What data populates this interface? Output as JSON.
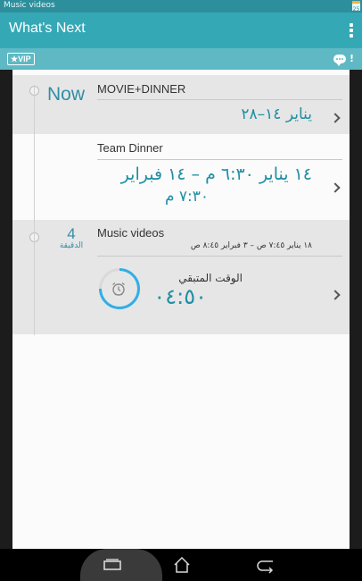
{
  "status_bar": {
    "text": "Music videos",
    "calendar_day": "25"
  },
  "app_bar": {
    "title": "What's Next",
    "menu_icon": "overflow-icon"
  },
  "vip_bar": {
    "badge": "★VIP",
    "alert_mark": "!",
    "chat_icon": "chat-icon"
  },
  "timeline": {
    "now_label": "Now",
    "events": [
      {
        "title": "MOVIE+DINNER",
        "date": "يناير ١٤–٢٨"
      },
      {
        "title": "Team Dinner",
        "date_line1": "١٤ يناير ٦:٣٠ م – ١٤ فبراير",
        "date_line2": "٧:٣٠ م"
      },
      {
        "title": "Music videos",
        "date": "١٨ يناير ٧:٤٥ ص – ٣ فبراير ٨:٤٥ ص",
        "duration_value": "4",
        "duration_unit": "الدقيقة",
        "remaining_label": "الوقت المتبقي",
        "remaining_value": "٠٤:٥٠",
        "alarm_icon": "alarm-clock-icon"
      }
    ]
  },
  "colors": {
    "status_bar": "#2e8f9c",
    "app_bar": "#35a8b6",
    "vip_bar": "#5eb9c4",
    "accent_text": "#1e8fa3",
    "timer_ring": "#31aee6"
  }
}
